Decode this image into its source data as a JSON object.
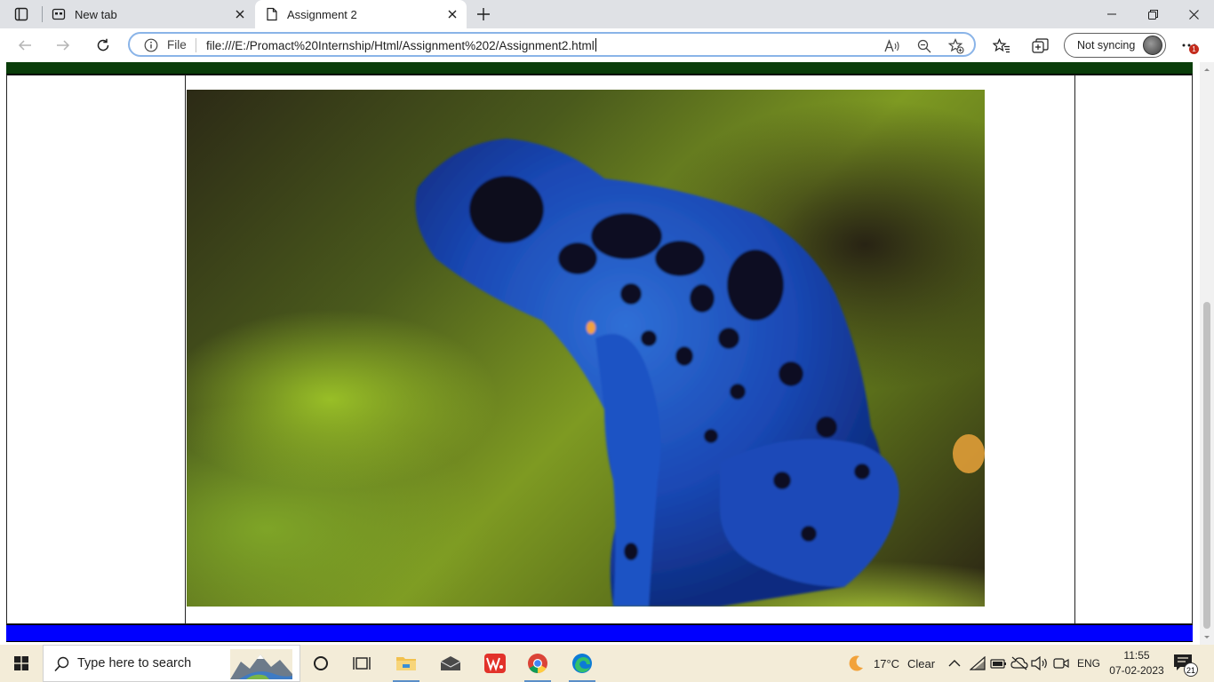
{
  "browser": {
    "tabs": [
      {
        "label": "New tab",
        "active": false
      },
      {
        "label": "Assignment 2",
        "active": true
      }
    ],
    "address": {
      "scheme_label": "File",
      "url": "file:///E:/Promact%20Internship/Html/Assignment%202/Assignment2.html"
    },
    "sync_label": "Not syncing",
    "more_badge": "1"
  },
  "page": {
    "image_description": "Blue poison dart frog photo",
    "colors": {
      "header_band": "#0a3d0a",
      "footer_band": "#0000ff",
      "table_border": "#222222"
    }
  },
  "taskbar": {
    "search_placeholder": "Type here to search",
    "weather": {
      "temperature": "17°C",
      "condition": "Clear"
    },
    "language": "ENG",
    "clock": {
      "time": "11:55",
      "date": "07-02-2023"
    },
    "notification_count": "21",
    "apps": [
      "cortana",
      "task-view",
      "file-explorer",
      "mail",
      "wps-office",
      "chrome",
      "edge"
    ]
  }
}
